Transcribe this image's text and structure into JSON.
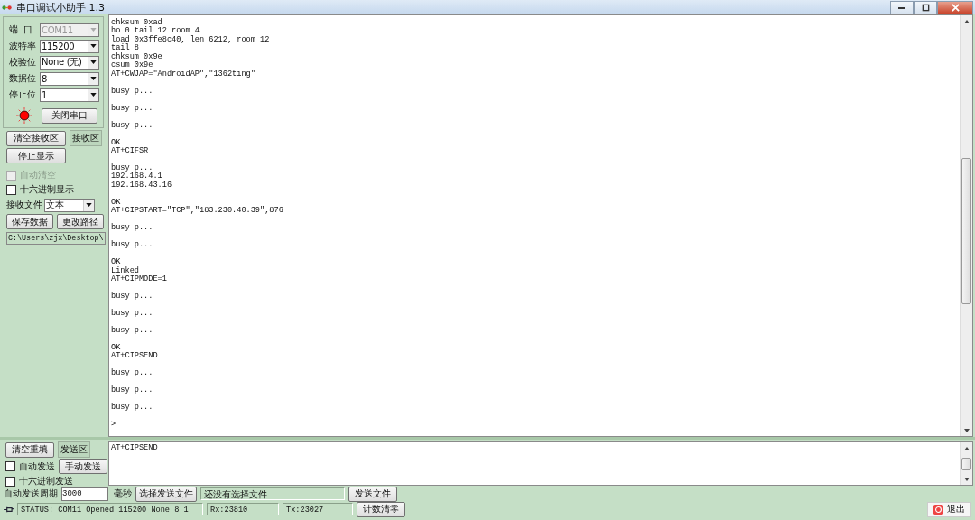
{
  "window": {
    "title": "串口调试小助手 1.3"
  },
  "settings": [
    {
      "label": "端  口",
      "value": "COM11",
      "disabled": true
    },
    {
      "label": "波特率",
      "value": "115200",
      "disabled": false
    },
    {
      "label": "校验位",
      "value": "None (无)",
      "disabled": false
    },
    {
      "label": "数据位",
      "value": "8",
      "disabled": false
    },
    {
      "label": "停止位",
      "value": "1",
      "disabled": false
    }
  ],
  "port_led": {
    "on": true
  },
  "close_port_button": "关闭串口",
  "receive_controls": {
    "clear_button": "清空接收区",
    "area_label": "接收区",
    "stop_button": "停止显示",
    "checkboxes": [
      {
        "label": "自动清空",
        "checked": false,
        "disabled": true
      },
      {
        "label": "十六进制显示",
        "checked": false,
        "disabled": false
      }
    ],
    "receive_file": {
      "label": "接收文件",
      "value": "文本"
    },
    "save_button": "保存数据",
    "change_path_button": "更改路径",
    "path": "C:\\Users\\zjx\\Desktop\\"
  },
  "receive_log": "chksum 0xad\nho 0 tail 12 room 4\nload 0x3ffe8c40, len 6212, room 12\ntail 8\nchksum 0x9e\ncsum 0x9e\nAT+CWJAP=\"AndroidAP\",\"1362ting\"\n\nbusy p...\n\nbusy p...\n\nbusy p...\n\nOK\nAT+CIFSR\n\nbusy p...\n192.168.4.1\n192.168.43.16\n\nOK\nAT+CIPSTART=\"TCP\",\"183.230.40.39\",876\n\nbusy p...\n\nbusy p...\n\nOK\nLinked\nAT+CIPMODE=1\n\nbusy p...\n\nbusy p...\n\nbusy p...\n\nOK\nAT+CIPSEND\n\nbusy p...\n\nbusy p...\n\nbusy p...\n\n>",
  "send_controls": {
    "clear_button": "清空重填",
    "area_label": "发送区",
    "auto_send": {
      "label": "自动发送",
      "checked": false
    },
    "manual_button": "手动发送",
    "hex_send": {
      "label": "十六进制发送",
      "checked": false
    },
    "period_label": "自动发送周期",
    "period_value": "3000",
    "unit": "毫秒",
    "choose_file_button": "选择发送文件",
    "file_status": "还没有选择文件",
    "send_file_button": "发送文件"
  },
  "send_text": "AT+CIPSEND",
  "status_bar": {
    "status": "STATUS: COM11 Opened 115200 None  8 1",
    "rx": "Rx:23810",
    "tx": "Tx:23027",
    "reset_button": "计数清零"
  },
  "exit_button": "退出"
}
